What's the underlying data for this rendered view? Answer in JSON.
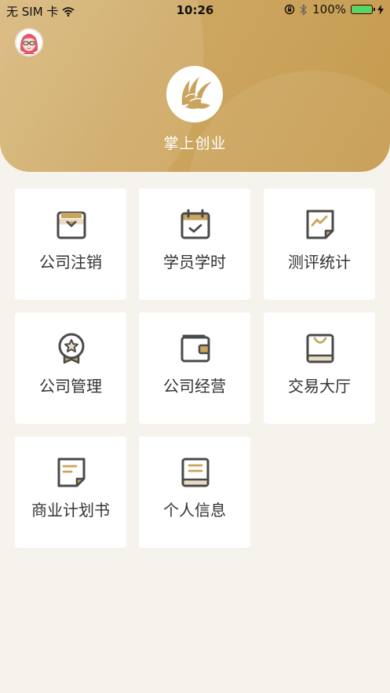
{
  "status_bar": {
    "carrier": "无 SIM 卡",
    "time": "10:26",
    "battery": "100%"
  },
  "header": {
    "title": "掌上创业"
  },
  "colors": {
    "accent": "#c9a45f",
    "icon_stroke": "#4a4a4a",
    "background": "#f6f2ec"
  },
  "menu": [
    {
      "label": "公司注销",
      "icon": "archive-box-icon"
    },
    {
      "label": "学员学时",
      "icon": "calendar-check-icon"
    },
    {
      "label": "测评统计",
      "icon": "chart-note-icon"
    },
    {
      "label": "公司管理",
      "icon": "badge-star-icon"
    },
    {
      "label": "公司经营",
      "icon": "wallet-icon"
    },
    {
      "label": "交易大厅",
      "icon": "shopping-bag-icon"
    },
    {
      "label": "商业计划书",
      "icon": "document-icon"
    },
    {
      "label": "个人信息",
      "icon": "book-icon"
    }
  ]
}
